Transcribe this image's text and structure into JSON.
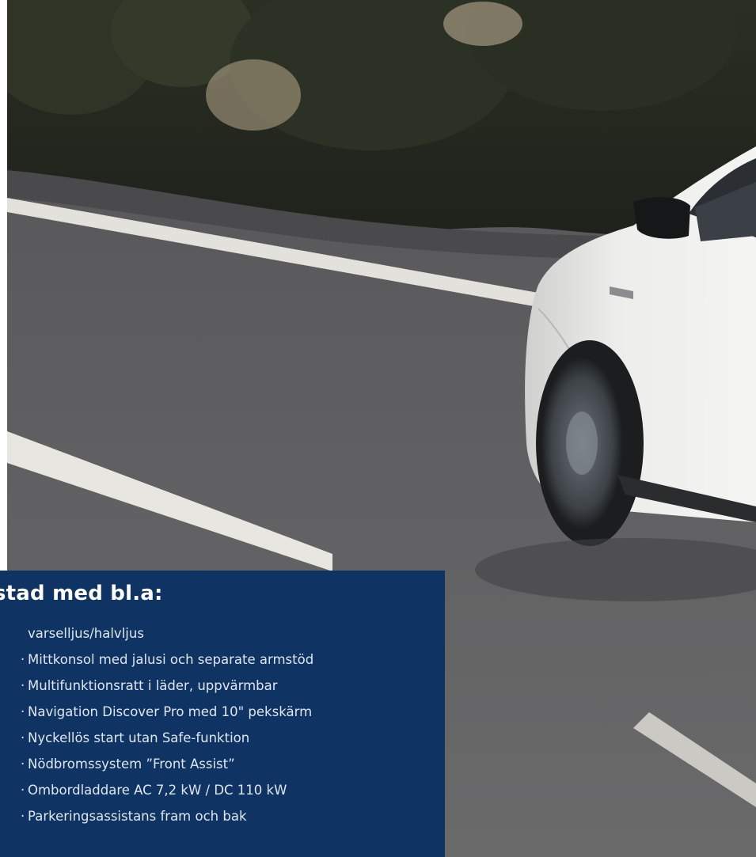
{
  "hero": {
    "image": "car-driving-road-dusk",
    "colors": {
      "sky": "#c9b79b",
      "trees": "#2b3024",
      "road": "#5f5f61",
      "lane_marking": "#e3e1dc",
      "car_body": "#e6e6e4"
    }
  },
  "panel": {
    "background": "#0f3463",
    "heading": "stad med bl.a:",
    "items": [
      {
        "text": "varselljus/halvljus",
        "continuation": true
      },
      {
        "text": "Mittkonsol med jalusi och separate armstöd",
        "continuation": false
      },
      {
        "text": "Multifunktionsratt i läder, uppvärmbar",
        "continuation": false
      },
      {
        "text": "Navigation Discover Pro med 10\" pekskärm",
        "continuation": false
      },
      {
        "text": "Nyckellös start utan Safe-funktion",
        "continuation": false
      },
      {
        "text": "Nödbromssystem ”Front Assist”",
        "continuation": false
      },
      {
        "text": "Ombordladdare AC 7,2 kW / DC 110 kW",
        "continuation": false
      },
      {
        "text": "Parkeringsassistans fram och bak",
        "continuation": false
      }
    ],
    "bullet_glyph": "·"
  }
}
